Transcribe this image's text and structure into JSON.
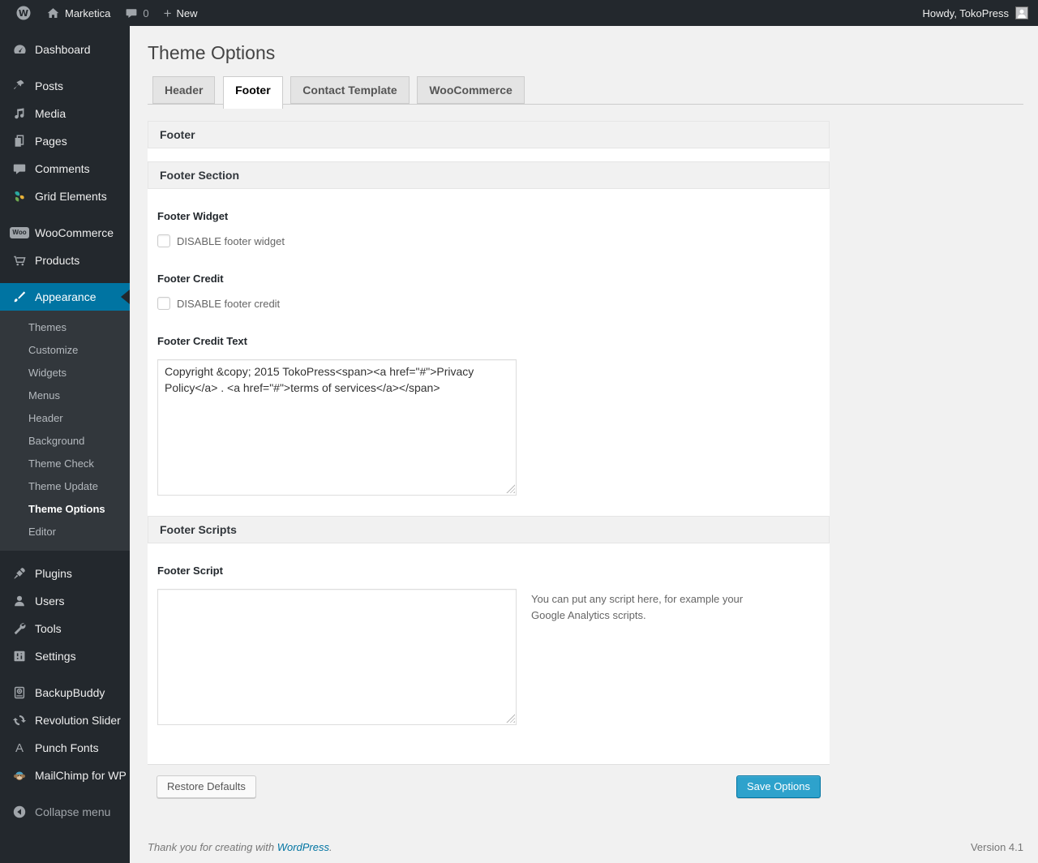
{
  "admin_bar": {
    "site_name": "Marketica",
    "comments_count": "0",
    "new_label": "New",
    "howdy": "Howdy, TokoPress"
  },
  "sidebar": {
    "items": [
      {
        "label": "Dashboard"
      },
      {
        "label": "Posts"
      },
      {
        "label": "Media"
      },
      {
        "label": "Pages"
      },
      {
        "label": "Comments"
      },
      {
        "label": "Grid Elements"
      },
      {
        "label": "WooCommerce"
      },
      {
        "label": "Products"
      },
      {
        "label": "Appearance"
      },
      {
        "label": "Plugins"
      },
      {
        "label": "Users"
      },
      {
        "label": "Tools"
      },
      {
        "label": "Settings"
      },
      {
        "label": "BackupBuddy"
      },
      {
        "label": "Revolution Slider"
      },
      {
        "label": "Punch Fonts"
      },
      {
        "label": "MailChimp for WP"
      },
      {
        "label": "Collapse menu"
      }
    ],
    "submenu": [
      {
        "label": "Themes"
      },
      {
        "label": "Customize"
      },
      {
        "label": "Widgets"
      },
      {
        "label": "Menus"
      },
      {
        "label": "Header"
      },
      {
        "label": "Background"
      },
      {
        "label": "Theme Check"
      },
      {
        "label": "Theme Update"
      },
      {
        "label": "Theme Options"
      },
      {
        "label": "Editor"
      }
    ],
    "woo_badge_text": "Woo",
    "punch_fonts_glyph": "A"
  },
  "main": {
    "title": "Theme Options",
    "tabs": [
      {
        "label": "Header"
      },
      {
        "label": "Footer"
      },
      {
        "label": "Contact Template"
      },
      {
        "label": "WooCommerce"
      }
    ],
    "panel": {
      "footer_bar_label": "Footer",
      "footer_section_label": "Footer Section",
      "footer_widget_label": "Footer Widget",
      "disable_footer_widget_label": "DISABLE footer widget",
      "footer_credit_label": "Footer Credit",
      "disable_footer_credit_label": "DISABLE footer credit",
      "footer_credit_text_label": "Footer Credit Text",
      "footer_credit_text_value": "Copyright &copy; 2015 TokoPress<span><a href=\"#\">Privacy Policy</a> . <a href=\"#\">terms of services</a></span>",
      "footer_scripts_label": "Footer Scripts",
      "footer_script_label": "Footer Script",
      "footer_script_value": "",
      "footer_script_help": "You can put any script here, for example your Google Analytics scripts.",
      "restore_defaults_label": "Restore Defaults",
      "save_options_label": "Save Options"
    }
  },
  "page_footer": {
    "thanks_prefix": "Thank you for creating with ",
    "wordpress_link": "WordPress",
    "thanks_suffix": ".",
    "version": "Version 4.1"
  },
  "colors": {
    "admin_bar_bg": "#23282d",
    "submenu_bg": "#32373c",
    "active_menu_blue": "#0074a2",
    "primary_button_blue": "#2ea2cc",
    "content_bg": "#f1f1f1",
    "link_blue": "#0074a2"
  }
}
